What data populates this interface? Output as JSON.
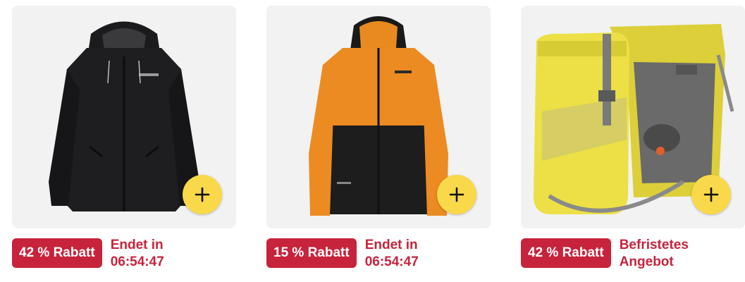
{
  "colors": {
    "deal_red": "#c7233c",
    "add_button_yellow": "#f9d949",
    "card_background": "#f2f2f2"
  },
  "products": [
    {
      "image_icon": "black-jacket-image",
      "add_icon": "plus-icon",
      "discount_label": "42 % Rabatt",
      "deal_label": "Endet in\n06:54:47"
    },
    {
      "image_icon": "orange-black-jacket-image",
      "add_icon": "plus-icon",
      "discount_label": "15 % Rabatt",
      "deal_label": "Endet in\n06:54:47"
    },
    {
      "image_icon": "yellow-bike-pannier-image",
      "add_icon": "plus-icon",
      "discount_label": "42 % Rabatt",
      "deal_label": "Befristetes\nAngebot"
    }
  ]
}
